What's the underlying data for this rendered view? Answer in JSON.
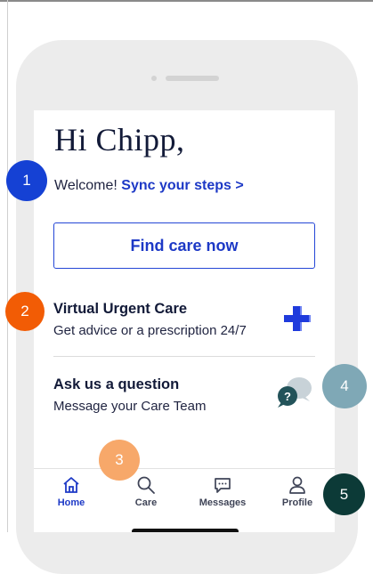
{
  "home": {
    "greeting": "Hi Chipp,",
    "welcome": "Welcome! ",
    "sync_link": "Sync your steps",
    "sync_chevron": ">",
    "find_care_button": "Find care now"
  },
  "cards": [
    {
      "title": "Virtual Urgent Care",
      "subtitle": "Get advice or a prescription 24/7",
      "icon": "medical-cross-icon"
    },
    {
      "title": "Ask us a question",
      "subtitle": "Message your Care Team",
      "icon": "chat-question-icon"
    }
  ],
  "tabbar": {
    "active": "Home",
    "items": [
      {
        "label": "Home",
        "icon": "home-icon"
      },
      {
        "label": "Care",
        "icon": "search-icon"
      },
      {
        "label": "Messages",
        "icon": "message-icon"
      },
      {
        "label": "Profile",
        "icon": "profile-icon"
      }
    ]
  },
  "annotations": [
    "1",
    "2",
    "3",
    "4",
    "5"
  ],
  "colors": {
    "accent": "#1d39c6",
    "text": "#121a38",
    "marker_1": "#1541d4",
    "marker_2": "#f25c05",
    "marker_3": "#f7a86a",
    "marker_4": "#7fa8b6",
    "marker_5": "#0c3a37"
  }
}
